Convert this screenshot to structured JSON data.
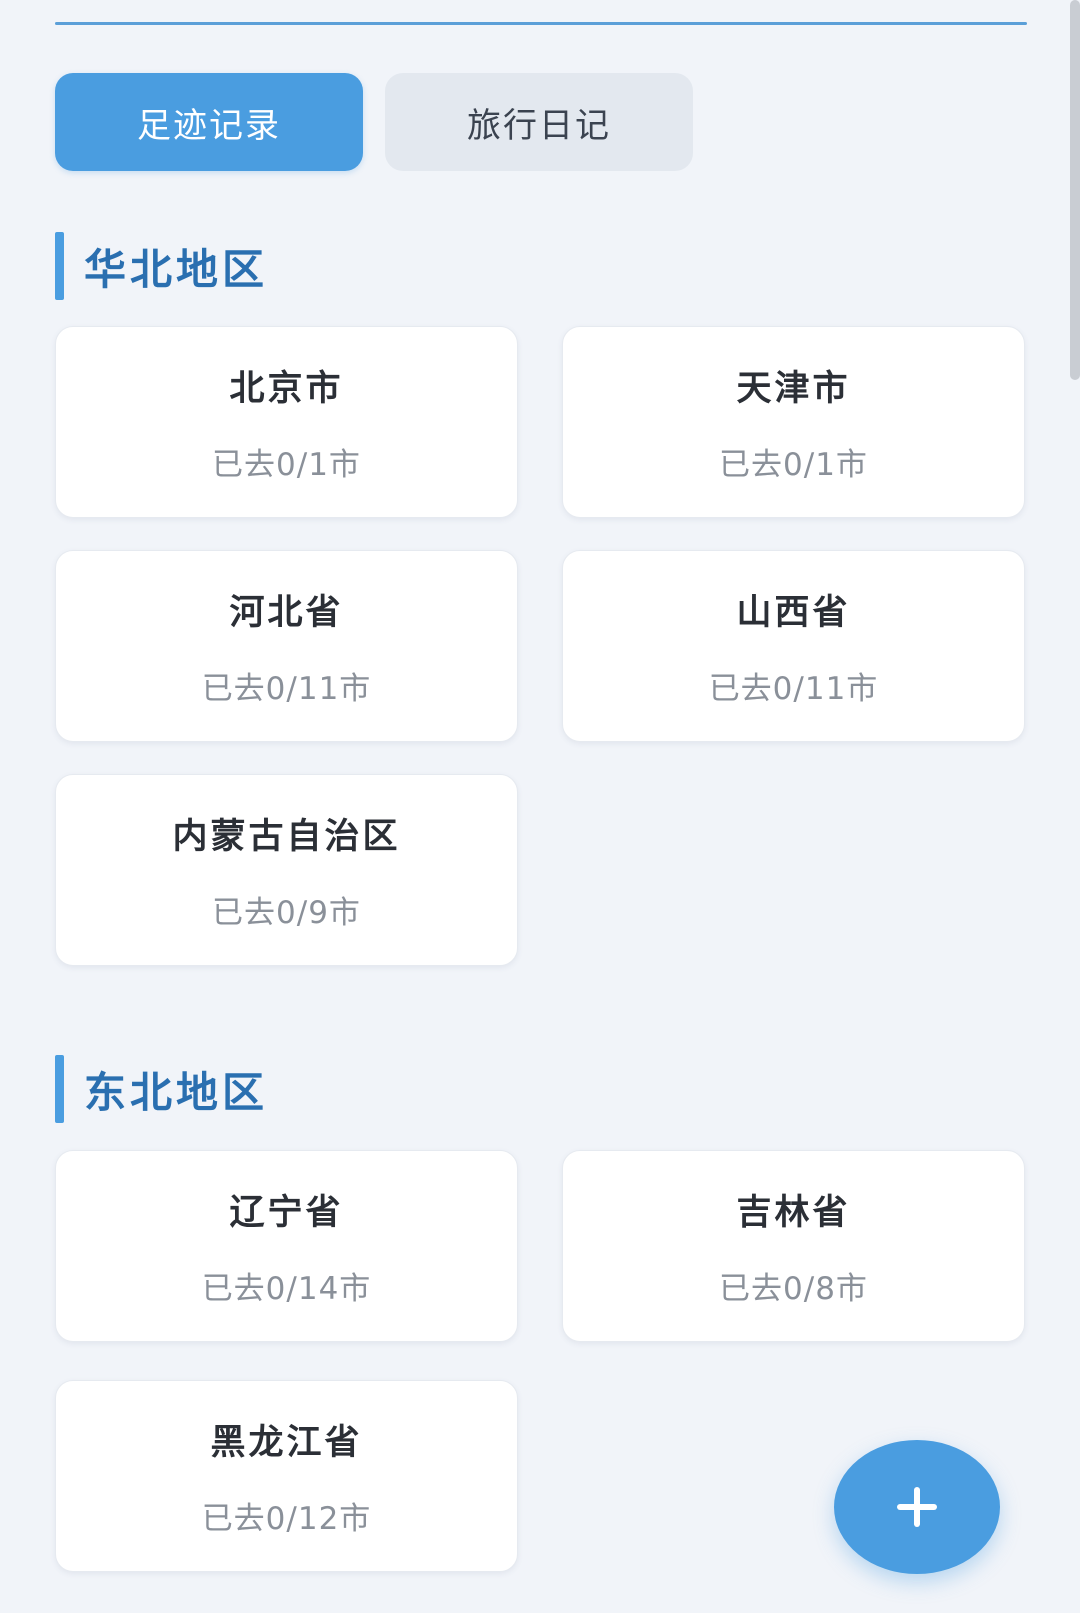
{
  "tabs": [
    {
      "label": "足迹记录",
      "active": true
    },
    {
      "label": "旅行日记",
      "active": false
    }
  ],
  "regions": [
    {
      "title": "华北地区",
      "provinces": [
        {
          "name": "北京市",
          "visited": "已去0/1市"
        },
        {
          "name": "天津市",
          "visited": "已去0/1市"
        },
        {
          "name": "河北省",
          "visited": "已去0/11市"
        },
        {
          "name": "山西省",
          "visited": "已去0/11市"
        },
        {
          "name": "内蒙古自治区",
          "visited": "已去0/9市"
        }
      ]
    },
    {
      "title": "东北地区",
      "provinces": [
        {
          "name": "辽宁省",
          "visited": "已去0/14市"
        },
        {
          "name": "吉林省",
          "visited": "已去0/8市"
        },
        {
          "name": "黑龙江省",
          "visited": "已去0/12市"
        }
      ]
    }
  ],
  "fab": {
    "icon": "plus-icon"
  },
  "colors": {
    "accent": "#4a9de0",
    "section_title": "#2a6fb0",
    "background": "#f1f4f9"
  }
}
